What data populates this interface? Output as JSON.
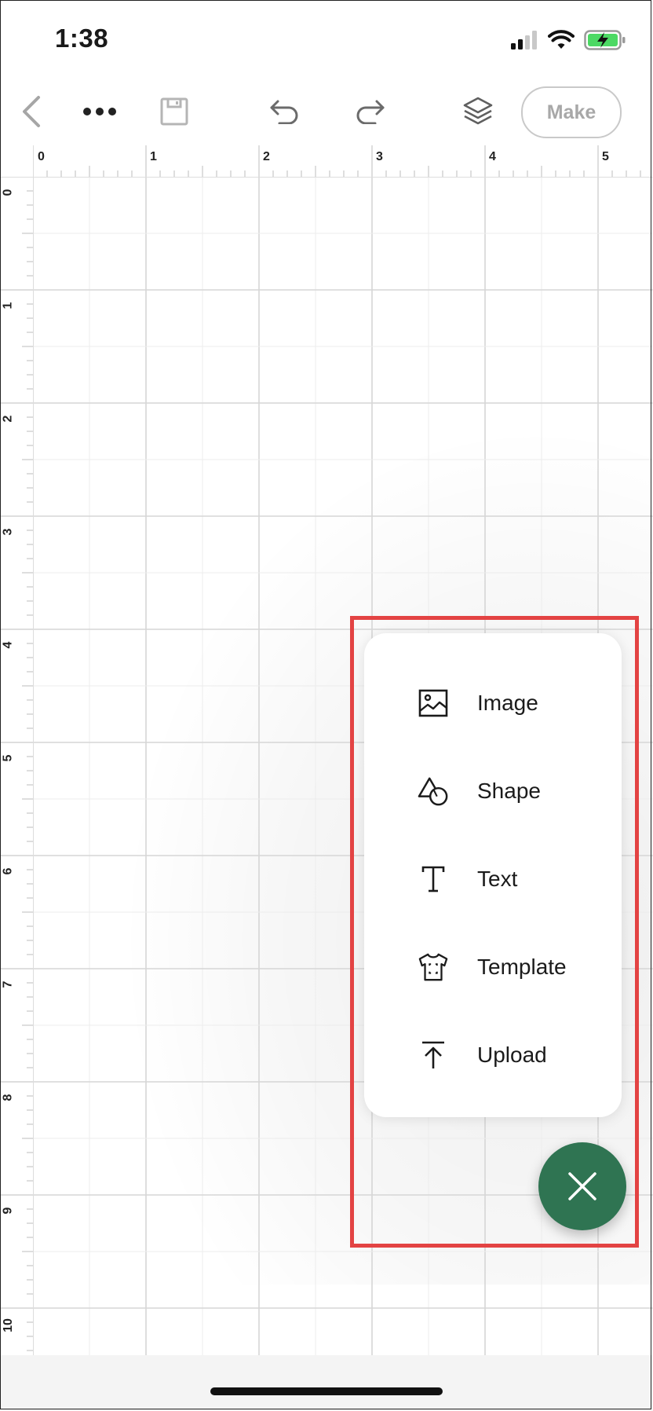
{
  "status": {
    "time": "1:38"
  },
  "toolbar": {
    "make_label": "Make"
  },
  "ruler": {
    "top_labels": [
      "0",
      "1",
      "2",
      "3",
      "4",
      "5"
    ],
    "left_labels": [
      "0",
      "1",
      "2",
      "3",
      "4",
      "5",
      "6",
      "7",
      "8",
      "9",
      "10"
    ]
  },
  "menu": {
    "items": [
      {
        "label": "Image",
        "icon": "image-icon"
      },
      {
        "label": "Shape",
        "icon": "shape-icon"
      },
      {
        "label": "Text",
        "icon": "text-icon"
      },
      {
        "label": "Template",
        "icon": "template-shirt-icon"
      },
      {
        "label": "Upload",
        "icon": "upload-icon"
      }
    ],
    "close_icon": "close-icon"
  },
  "colors": {
    "fab": "#2f7452",
    "highlight": "#e34343",
    "battery": "#4cd964"
  }
}
